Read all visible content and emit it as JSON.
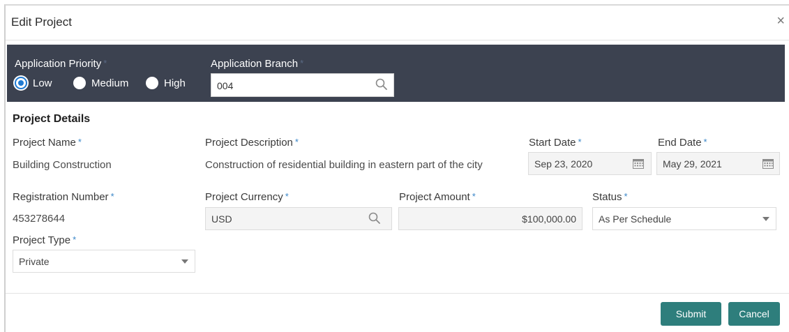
{
  "dialog": {
    "title": "Edit Project",
    "close_glyph": "×"
  },
  "app": {
    "priority_label": "Application Priority",
    "priority_options": [
      "Low",
      "Medium",
      "High"
    ],
    "priority_selected": "Low",
    "branch_label": "Application Branch",
    "branch_value": "004"
  },
  "details": {
    "section_title": "Project Details",
    "project_name_label": "Project Name",
    "project_name_value": "Building Construction",
    "project_desc_label": "Project Description",
    "project_desc_value": "Construction of residential building in eastern part of the city",
    "start_date_label": "Start Date",
    "start_date_value": "Sep 23, 2020",
    "end_date_label": "End Date",
    "end_date_value": "May 29, 2021",
    "reg_number_label": "Registration Number",
    "reg_number_value": "453278644",
    "currency_label": "Project Currency",
    "currency_value": "USD",
    "amount_label": "Project Amount",
    "amount_value": "$100,000.00",
    "status_label": "Status",
    "status_value": "As Per Schedule",
    "type_label": "Project Type",
    "type_value": "Private"
  },
  "footer": {
    "submit_label": "Submit",
    "cancel_label": "Cancel"
  },
  "required_marker": "*",
  "colors": {
    "header_band": "#3c4250",
    "primary_button": "#2e7e7c",
    "required_star": "#3a86c8",
    "radio_selected": "#1f7ad1"
  }
}
